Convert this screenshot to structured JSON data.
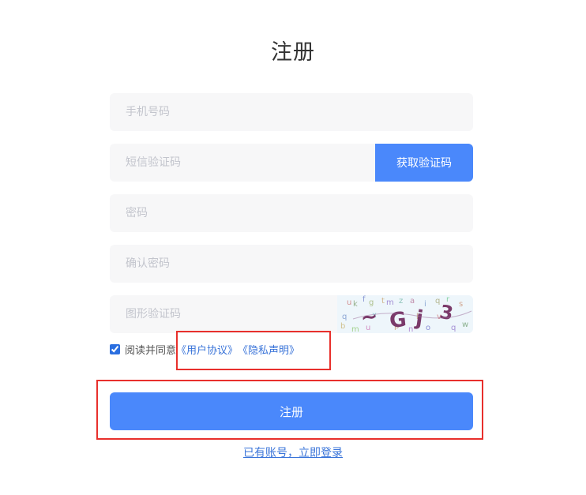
{
  "page": {
    "title": "注册"
  },
  "form": {
    "phone_placeholder": "手机号码",
    "sms_placeholder": "短信验证码",
    "sms_button": "获取验证码",
    "password_placeholder": "密码",
    "confirm_placeholder": "确认密码",
    "captcha_placeholder": "图形验证码",
    "captcha_text": "~Gj3"
  },
  "agreement": {
    "checked": true,
    "prefix": "阅读并同意",
    "user_agreement": "《用户协议》",
    "privacy_statement": "《隐私声明》"
  },
  "submit_label": "注册",
  "login_link": "已有账号，立即登录",
  "colors": {
    "primary": "#4a88fb",
    "link": "#3a74d9",
    "input_bg": "#f7f7f8",
    "annotation": "#e8302c"
  }
}
